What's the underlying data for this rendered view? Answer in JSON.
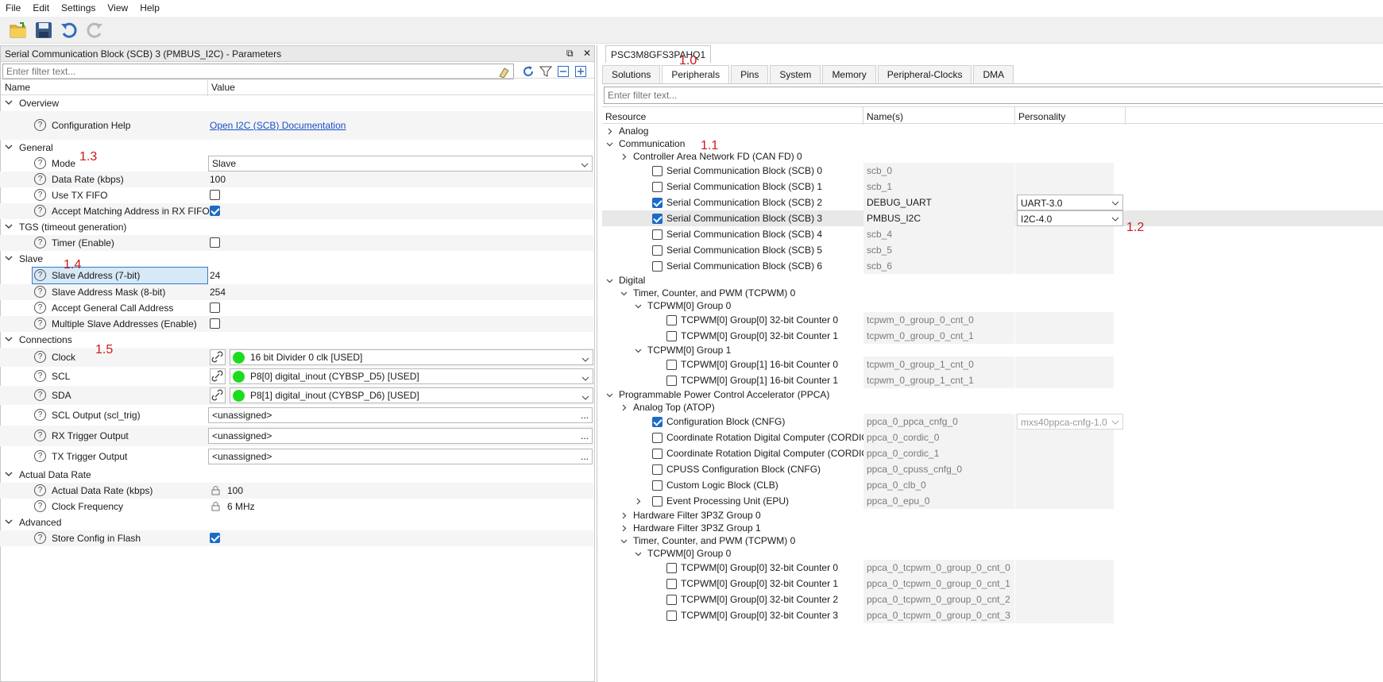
{
  "menu": [
    "File",
    "Edit",
    "Settings",
    "View",
    "Help"
  ],
  "left": {
    "title": "Serial Communication Block (SCB) 3 (PMBUS_I2C) - Parameters",
    "filter_placeholder": "Enter filter text...",
    "col_name": "Name",
    "col_value": "Value",
    "groups": {
      "overview": "Overview",
      "general": "General",
      "tgs": "TGS (timeout generation)",
      "slave": "Slave",
      "connections": "Connections",
      "actual": "Actual Data Rate",
      "advanced": "Advanced"
    },
    "params": {
      "config_help": "Configuration Help",
      "config_help_link": "Open I2C (SCB) Documentation",
      "mode": "Mode",
      "mode_value": "Slave",
      "data_rate": "Data Rate (kbps)",
      "data_rate_value": "100",
      "use_tx_fifo": "Use TX FIFO",
      "accept_match": "Accept Matching Address in RX FIFO",
      "timer": "Timer (Enable)",
      "slave_addr": "Slave Address (7-bit)",
      "slave_addr_value": "24",
      "slave_mask": "Slave Address Mask (8-bit)",
      "slave_mask_value": "254",
      "general_call": "Accept General Call Address",
      "multi_slave": "Multiple Slave Addresses (Enable)",
      "clock": "Clock",
      "clock_value": "16 bit Divider 0 clk [USED]",
      "scl": "SCL",
      "scl_value": "P8[0] digital_inout (CYBSP_D5) [USED]",
      "sda": "SDA",
      "sda_value": "P8[1] digital_inout (CYBSP_D6) [USED]",
      "scl_out": "SCL Output (scl_trig)",
      "rx_trig": "RX Trigger Output",
      "tx_trig": "TX Trigger Output",
      "unassigned": "<unassigned>",
      "dots": "...",
      "actual_rate": "Actual Data Rate (kbps)",
      "actual_rate_value": "100",
      "clock_freq": "Clock Frequency",
      "clock_freq_value": "6 MHz",
      "store_flash": "Store Config in Flash"
    },
    "checkboxes": {
      "use_tx_fifo": false,
      "accept_match": true,
      "timer": false,
      "general_call": false,
      "multi_slave": false,
      "store_flash": true
    },
    "annotations": {
      "a13": "1.3",
      "a14": "1.4",
      "a15": "1.5"
    }
  },
  "right": {
    "device_tab": "PSC3M8GFS3PAHQ1",
    "tabs": [
      "Solutions",
      "Peripherals",
      "Pins",
      "System",
      "Memory",
      "Peripheral-Clocks",
      "DMA"
    ],
    "active_tab": "Peripherals",
    "filter_placeholder": "Enter filter text...",
    "col_resource": "Resource",
    "col_names": "Name(s)",
    "col_personality": "Personality",
    "annotations": {
      "a10": "1.0",
      "a11": "1.1",
      "a12": "1.2"
    },
    "rows": [
      {
        "t": "Analog",
        "lvl": 0,
        "chev": "right"
      },
      {
        "t": "Communication",
        "lvl": 0,
        "chev": "down"
      },
      {
        "t": "Controller Area Network FD (CAN FD) 0",
        "lvl": 1,
        "chev": "right"
      },
      {
        "t": "Serial Communication Block (SCB) 0",
        "lvl": 2,
        "chk": false,
        "n": "scb_0"
      },
      {
        "t": "Serial Communication Block (SCB) 1",
        "lvl": 2,
        "chk": false,
        "n": "scb_1"
      },
      {
        "t": "Serial Communication Block (SCB) 2",
        "lvl": 2,
        "chk": true,
        "n": "DEBUG_UART",
        "p": "UART-3.0"
      },
      {
        "t": "Serial Communication Block (SCB) 3",
        "lvl": 2,
        "chk": true,
        "n": "PMBUS_I2C",
        "p": "I2C-4.0",
        "sel": true
      },
      {
        "t": "Serial Communication Block (SCB) 4",
        "lvl": 2,
        "chk": false,
        "n": "scb_4"
      },
      {
        "t": "Serial Communication Block (SCB) 5",
        "lvl": 2,
        "chk": false,
        "n": "scb_5"
      },
      {
        "t": "Serial Communication Block (SCB) 6",
        "lvl": 2,
        "chk": false,
        "n": "scb_6"
      },
      {
        "t": "Digital",
        "lvl": 0,
        "chev": "down"
      },
      {
        "t": "Timer, Counter, and PWM (TCPWM) 0",
        "lvl": 1,
        "chev": "down"
      },
      {
        "t": "TCPWM[0] Group 0",
        "lvl": 2,
        "chev": "down"
      },
      {
        "t": "TCPWM[0] Group[0] 32-bit Counter 0",
        "lvl": 3,
        "chk": false,
        "n": "tcpwm_0_group_0_cnt_0"
      },
      {
        "t": "TCPWM[0] Group[0] 32-bit Counter 1",
        "lvl": 3,
        "chk": false,
        "n": "tcpwm_0_group_0_cnt_1"
      },
      {
        "t": "TCPWM[0] Group 1",
        "lvl": 2,
        "chev": "down"
      },
      {
        "t": "TCPWM[0] Group[1] 16-bit Counter 0",
        "lvl": 3,
        "chk": false,
        "n": "tcpwm_0_group_1_cnt_0"
      },
      {
        "t": "TCPWM[0] Group[1] 16-bit Counter 1",
        "lvl": 3,
        "chk": false,
        "n": "tcpwm_0_group_1_cnt_1"
      },
      {
        "t": "Programmable Power Control Accelerator (PPCA)",
        "lvl": 0,
        "chev": "down"
      },
      {
        "t": "Analog Top (ATOP)",
        "lvl": 1,
        "chev": "right"
      },
      {
        "t": "Configuration Block (CNFG)",
        "lvl": 2,
        "chk": true,
        "n": "ppca_0_ppca_cnfg_0",
        "p": "mxs40ppca-cnfg-1.0",
        "pgrey": true
      },
      {
        "t": "Coordinate Rotation Digital Computer (CORDIC) 0",
        "lvl": 2,
        "chk": false,
        "n": "ppca_0_cordic_0"
      },
      {
        "t": "Coordinate Rotation Digital Computer (CORDIC) 1",
        "lvl": 2,
        "chk": false,
        "n": "ppca_0_cordic_1"
      },
      {
        "t": "CPUSS Configuration Block (CNFG)",
        "lvl": 2,
        "chk": false,
        "n": "ppca_0_cpuss_cnfg_0"
      },
      {
        "t": "Custom Logic Block (CLB)",
        "lvl": 2,
        "chk": false,
        "n": "ppca_0_clb_0"
      },
      {
        "t": "Event Processing Unit (EPU)",
        "lvl": 2,
        "chk": false,
        "n": "ppca_0_epu_0",
        "chev": "right"
      },
      {
        "t": "Hardware Filter 3P3Z Group 0",
        "lvl": 1,
        "chev": "right"
      },
      {
        "t": "Hardware Filter 3P3Z Group 1",
        "lvl": 1,
        "chev": "right"
      },
      {
        "t": "Timer, Counter, and PWM (TCPWM) 0",
        "lvl": 1,
        "chev": "down"
      },
      {
        "t": "TCPWM[0] Group 0",
        "lvl": 2,
        "chev": "down"
      },
      {
        "t": "TCPWM[0] Group[0] 32-bit Counter 0",
        "lvl": 3,
        "chk": false,
        "n": "ppca_0_tcpwm_0_group_0_cnt_0"
      },
      {
        "t": "TCPWM[0] Group[0] 32-bit Counter 1",
        "lvl": 3,
        "chk": false,
        "n": "ppca_0_tcpwm_0_group_0_cnt_1"
      },
      {
        "t": "TCPWM[0] Group[0] 32-bit Counter 2",
        "lvl": 3,
        "chk": false,
        "n": "ppca_0_tcpwm_0_group_0_cnt_2"
      },
      {
        "t": "TCPWM[0] Group[0] 32-bit Counter 3",
        "lvl": 3,
        "chk": false,
        "n": "ppca_0_tcpwm_0_group_0_cnt_3"
      }
    ]
  }
}
